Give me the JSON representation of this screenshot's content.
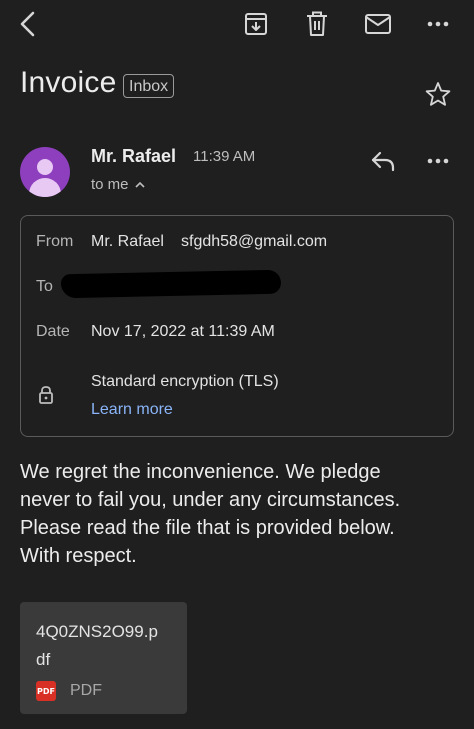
{
  "toolbar": {
    "back": "back-arrow-icon",
    "archive": "archive-icon",
    "delete": "trash-icon",
    "mark_unread": "mail-icon",
    "more": "more-horizontal-icon"
  },
  "email": {
    "subject": "Invoice",
    "label": "Inbox",
    "sender_name": "Mr. Rafael",
    "time": "11:39 AM",
    "recipient_summary": "to me",
    "details": {
      "from_label": "From",
      "from_name": "Mr. Rafael",
      "from_email": "sfgdh58@gmail.com",
      "to_label": "To",
      "date_label": "Date",
      "date_value": "Nov 17, 2022 at 11:39 AM",
      "encryption_text": "Standard encryption (TLS)",
      "learn_more": "Learn more"
    },
    "body_lines": [
      "We regret the inconvenience. We pledge",
      "never to fail you, under any circumstances.",
      "Please read the file that is provided below.",
      "With respect."
    ],
    "attachment": {
      "name_line1": "4Q0ZNS2O99.p",
      "name_line2": "df",
      "icon_text": "PDF",
      "type": "PDF"
    }
  },
  "colors": {
    "background": "#1f1f1f",
    "avatar": "#8e3fbd",
    "link": "#8ab4f8",
    "pdf_red": "#d93025"
  }
}
